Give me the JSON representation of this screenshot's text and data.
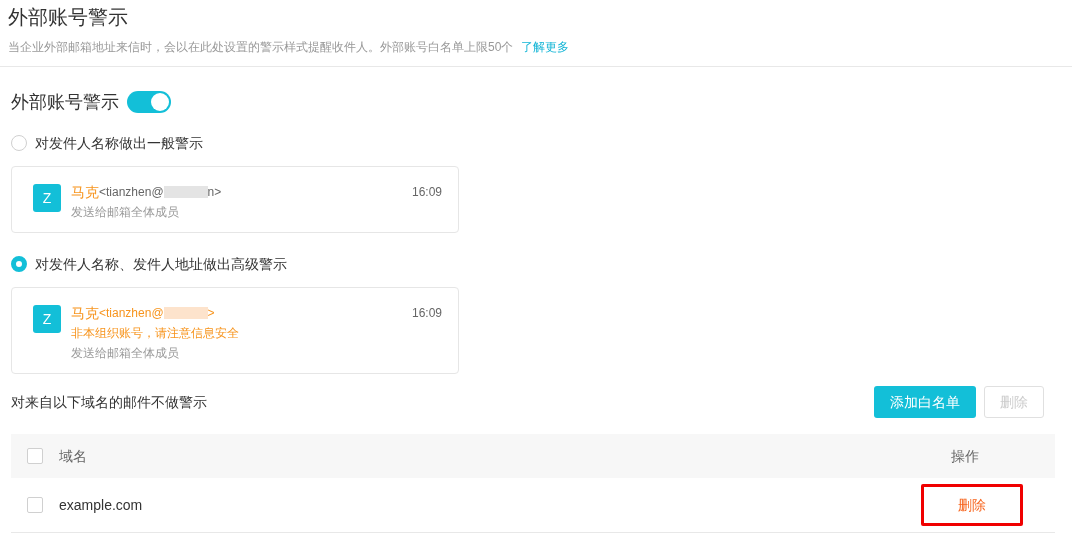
{
  "header": {
    "title": "外部账号警示",
    "description": "当企业外部邮箱地址来信时，会以在此处设置的警示样式提醒收件人。外部账号白名单上限50个",
    "link": "了解更多"
  },
  "warning_toggle": {
    "label": "外部账号警示",
    "on": true
  },
  "options": [
    {
      "label": "对发件人名称做出一般警示",
      "selected": false,
      "preview": {
        "avatar": "Z",
        "sender": "马克",
        "address_start": "<tianzhen@",
        "address_end": "n>",
        "time": "16:09",
        "recipients": "发送给邮箱全体成员"
      }
    },
    {
      "label": "对发件人名称、发件人地址做出高级警示",
      "selected": true,
      "preview": {
        "avatar": "Z",
        "sender": "马克",
        "address_start": "<tianzhen@",
        "address_end": ">",
        "time": "16:09",
        "notice": "非本组织账号，请注意信息安全",
        "recipients": "发送给邮箱全体成员"
      }
    }
  ],
  "whitelist": {
    "label": "对来自以下域名的邮件不做警示",
    "add_button": "添加白名单",
    "delete_button": {
      "label": "删除",
      "disabled": true
    },
    "select_all_checked": false,
    "columns": [
      "域名",
      "操作"
    ],
    "rows": [
      {
        "checked": false,
        "domain": "example.com",
        "action": "删除",
        "highlighted": true
      }
    ]
  }
}
